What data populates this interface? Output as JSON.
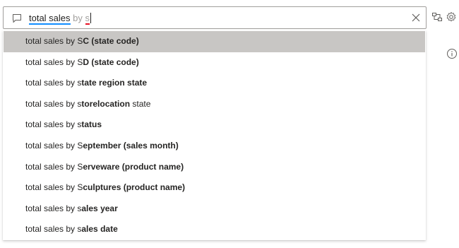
{
  "qa_input": {
    "typed": "total sales",
    "ghost_prefix": "by",
    "ghost_last": "s",
    "chat_icon": "chat-bubble-icon",
    "clear_icon": "close-icon"
  },
  "toolbar": {
    "hierarchy_icon": "hierarchy-icon",
    "settings_icon": "gear-icon",
    "info_icon": "info-icon"
  },
  "suggestions": [
    {
      "prefix": "total sales by ",
      "match": "S",
      "completion": "C (state code)",
      "selected": true
    },
    {
      "prefix": "total sales by ",
      "match": "S",
      "completion": "D (state code)",
      "selected": false
    },
    {
      "prefix": "total sales by ",
      "match": "s",
      "completion": "tate region state",
      "selected": false
    },
    {
      "prefix": "total sales by ",
      "match": "s",
      "completion": "torelocation",
      "suffix": " state",
      "selected": false
    },
    {
      "prefix": "total sales by ",
      "match": "s",
      "completion": "tatus",
      "selected": false
    },
    {
      "prefix": "total sales by ",
      "match": "S",
      "completion": "eptember (sales month)",
      "selected": false
    },
    {
      "prefix": "total sales by ",
      "match": "S",
      "completion": "erveware (product name)",
      "selected": false
    },
    {
      "prefix": "total sales by ",
      "match": "S",
      "completion": "culptures (product name)",
      "selected": false
    },
    {
      "prefix": "total sales by ",
      "match": "s",
      "completion": "ales year",
      "selected": false
    },
    {
      "prefix": "total sales by ",
      "match": "s",
      "completion": "ales date",
      "selected": false
    }
  ],
  "colors": {
    "accent": "#118dff",
    "error_underline": "#e81123",
    "selected_row": "#c8c6c4"
  }
}
